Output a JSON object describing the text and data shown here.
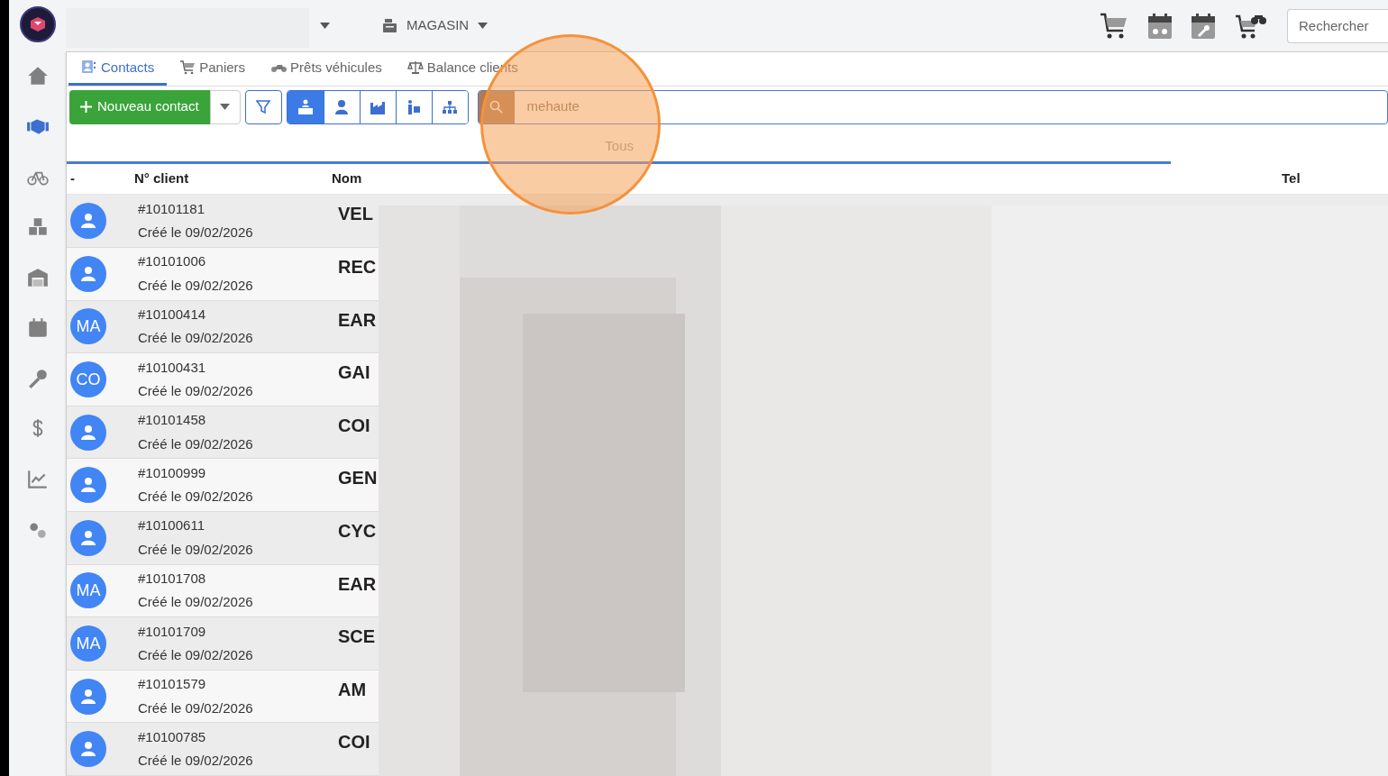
{
  "header": {
    "store": "MAGASIN",
    "search": {
      "placeholder": "Rechercher"
    }
  },
  "sidebar": {
    "items": [
      {
        "selected": false
      },
      {
        "selected": true
      },
      {
        "selected": false
      },
      {
        "selected": false
      },
      {
        "selected": false
      },
      {
        "selected": false
      },
      {
        "selected": false
      },
      {
        "selected": false
      },
      {
        "selected": false
      },
      {
        "selected": false
      }
    ]
  },
  "tabs": [
    {
      "label": "Contacts",
      "selected": true
    },
    {
      "label": "Paniers",
      "selected": false
    },
    {
      "label": "Prêts véhicules",
      "selected": false
    },
    {
      "label": "Balance clients",
      "selected": false
    }
  ],
  "toolbar": {
    "new_button": "Nouveau contact",
    "filters": [
      {
        "selected": true
      },
      {
        "selected": false
      },
      {
        "selected": false
      },
      {
        "selected": false
      },
      {
        "selected": false
      }
    ],
    "search_value": "mehaute",
    "scope": "Tous"
  },
  "table": {
    "columns": [
      "-",
      "N° client",
      "Nom",
      "Tel"
    ],
    "rows": [
      {
        "kind": "person",
        "number": "#10101181",
        "created": "Créé le 09/02/2026",
        "name": "VEL"
      },
      {
        "kind": "person",
        "number": "#10101006",
        "created": "Créé le 09/02/2026",
        "name": "REC"
      },
      {
        "kind": "initials",
        "initials": "MA",
        "number": "#10100414",
        "created": "Créé le 09/02/2026",
        "name": "EAR"
      },
      {
        "kind": "initials",
        "initials": "CO",
        "number": "#10100431",
        "created": "Créé le 09/02/2026",
        "name": "GAI"
      },
      {
        "kind": "person",
        "number": "#10101458",
        "created": "Créé le 09/02/2026",
        "name": "COI"
      },
      {
        "kind": "person",
        "number": "#10100999",
        "created": "Créé le 09/02/2026",
        "name": "GEN"
      },
      {
        "kind": "person",
        "number": "#10100611",
        "created": "Créé le 09/02/2026",
        "name": "CYC"
      },
      {
        "kind": "initials",
        "initials": "MA",
        "number": "#10101708",
        "created": "Créé le 09/02/2026",
        "name": "EAR"
      },
      {
        "kind": "initials",
        "initials": "MA",
        "number": "#10101709",
        "created": "Créé le 09/02/2026",
        "name": "SCE"
      },
      {
        "kind": "person",
        "number": "#10101579",
        "created": "Créé le 09/02/2026",
        "name": "AM"
      },
      {
        "kind": "person",
        "number": "#10100785",
        "created": "Créé le 09/02/2026",
        "name": "COI"
      }
    ]
  }
}
